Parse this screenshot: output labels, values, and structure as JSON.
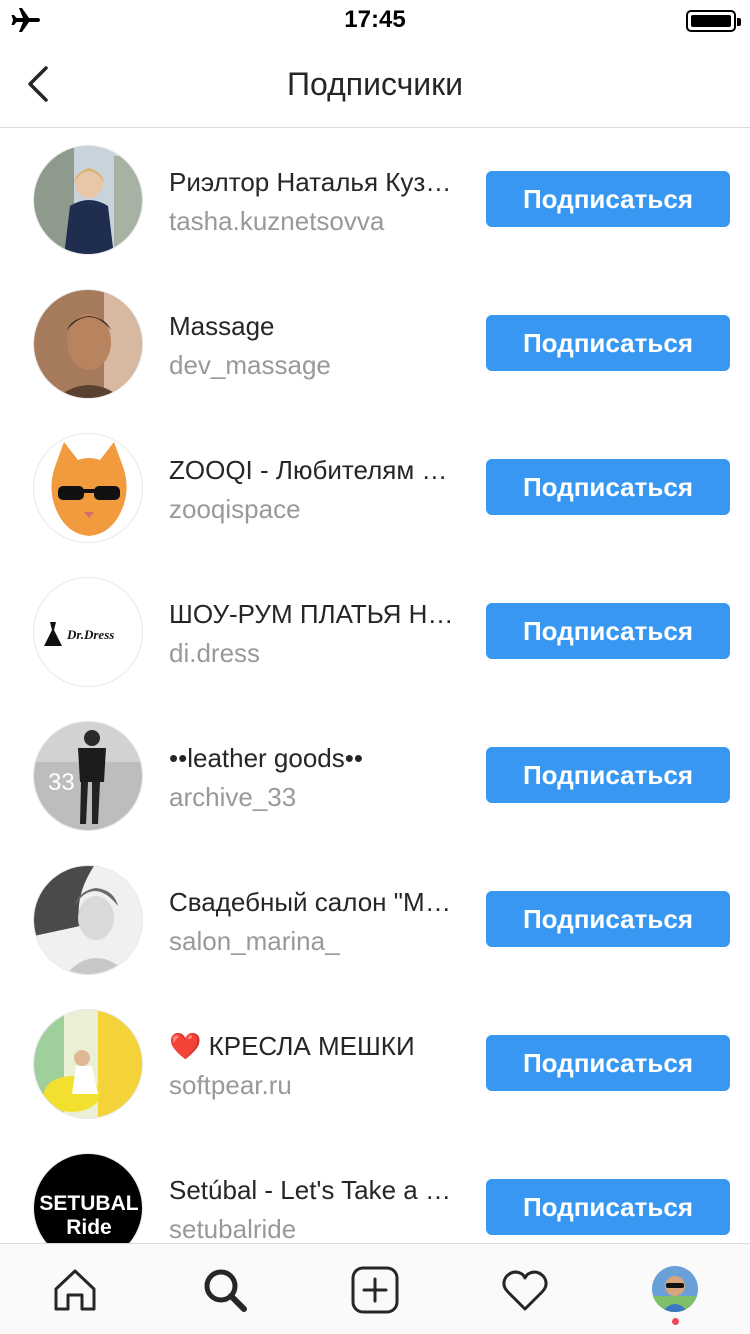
{
  "status_bar": {
    "time": "17:45",
    "left_icon": "airplane-icon",
    "right_icon": "battery-icon"
  },
  "nav": {
    "title": "Подписчики",
    "back_icon": "chevron-left-icon"
  },
  "accent_color": "#3897f0",
  "followers": [
    {
      "name": "Риэлтор Наталья Кузнецова",
      "handle": "tasha.kuznetsovva",
      "button": "Подписаться",
      "avatar": "woman-in-blue-suit-photo"
    },
    {
      "name": "Massage",
      "handle": "dev_massage",
      "button": "Подписаться",
      "avatar": "man-portrait-photo"
    },
    {
      "name": "ZOOQI - Любителям животных",
      "handle": "zooqispace",
      "button": "Подписаться",
      "avatar": "cat-with-sunglasses-photo"
    },
    {
      "name": "ШОУ-РУМ ПЛАТЬЯ НАПРОКАТ",
      "handle": "di.dress",
      "button": "Подписаться",
      "avatar": "di-dress-logo"
    },
    {
      "name": "••leather goods••",
      "handle": "archive_33",
      "button": "Подписаться",
      "avatar": "man-black-outfit-photo"
    },
    {
      "name": "Свадебный салон \"Марина\"",
      "handle": "salon_marina_",
      "button": "Подписаться",
      "avatar": "bride-bw-photo"
    },
    {
      "name": "❤️ КРЕСЛА МЕШКИ",
      "handle": "softpear.ru",
      "button": "Подписаться",
      "avatar": "yellow-beanbag-photo"
    },
    {
      "name": "Setúbal - Let's Take a Ride",
      "handle": "setubalride",
      "button": "Подписаться",
      "avatar": "setubal-ride-logo"
    }
  ],
  "avatar_texts": {
    "archive": "33",
    "didress": "Dr.Dress",
    "setubal_1": "SETUBAL",
    "setubal_2": "Ride"
  },
  "tab_bar": {
    "items": [
      "home-icon",
      "search-icon",
      "new-post-icon",
      "activity-heart-icon",
      "profile-avatar"
    ],
    "active": "search-icon",
    "notification_dot_color": "#ed4956"
  }
}
